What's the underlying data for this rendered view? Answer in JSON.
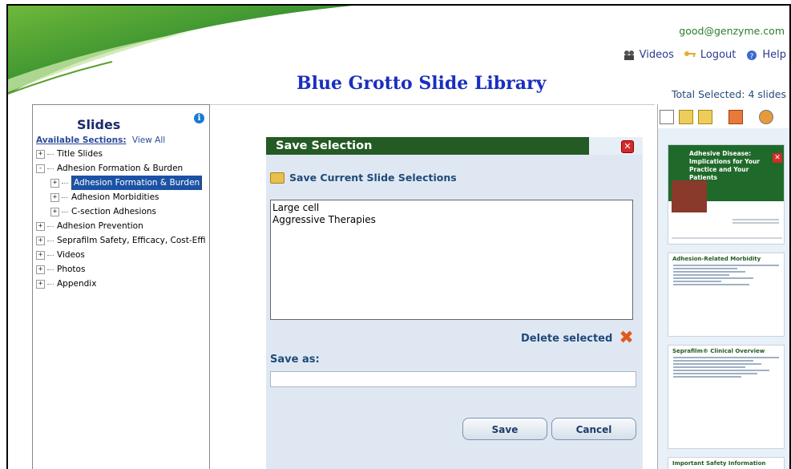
{
  "header": {
    "account_email": "good@genzyme.com",
    "links": [
      {
        "label": "Videos",
        "icon": "videos-icon"
      },
      {
        "label": "Logout",
        "icon": "logout-icon"
      },
      {
        "label": "Help",
        "icon": "help-icon"
      }
    ],
    "title": "Blue Grotto Slide Library",
    "total_selected": "Total Selected: 4 slides"
  },
  "sidebar": {
    "title": "Slides",
    "available_label": "Available Sections:",
    "view_all": "View All",
    "items": [
      {
        "label": "Title Slides",
        "expander": "+",
        "level": 0
      },
      {
        "label": "Adhesion Formation & Burden",
        "expander": "-",
        "level": 0
      },
      {
        "label": "Adhesion Formation & Burden",
        "expander": "+",
        "level": 1,
        "selected": true
      },
      {
        "label": "Adhesion Morbidities",
        "expander": "+",
        "level": 1
      },
      {
        "label": "C-section Adhesions",
        "expander": "+",
        "level": 1
      },
      {
        "label": "Adhesion Prevention",
        "expander": "+",
        "level": 0
      },
      {
        "label": "Seprafilm Safety, Efficacy, Cost-Effi",
        "expander": "+",
        "level": 0
      },
      {
        "label": "Videos",
        "expander": "+",
        "level": 0
      },
      {
        "label": "Photos",
        "expander": "+",
        "level": 0
      },
      {
        "label": "Appendix",
        "expander": "+",
        "level": 0
      }
    ]
  },
  "dialog": {
    "title": "Save Selection",
    "subtitle": "Save Current Slide Selections",
    "saved_selections": [
      "Large cell",
      "Aggressive Therapies"
    ],
    "delete_label": "Delete selected",
    "save_as_label": "Save as:",
    "save_as_value": "",
    "save_button": "Save",
    "cancel_button": "Cancel"
  },
  "thumbnails": [
    {
      "title": "Adhesive Disease: Implications for Your Practice and Your Patients"
    },
    {
      "title": "Adhesion-Related Morbidity"
    },
    {
      "title": "Seprafilm® Clinical Overview"
    },
    {
      "title": "Important Safety Information"
    }
  ],
  "colors": {
    "title_blue": "#1a2fbd",
    "dialog_header_green": "#245a24",
    "selected_blue": "#1c52a5"
  }
}
